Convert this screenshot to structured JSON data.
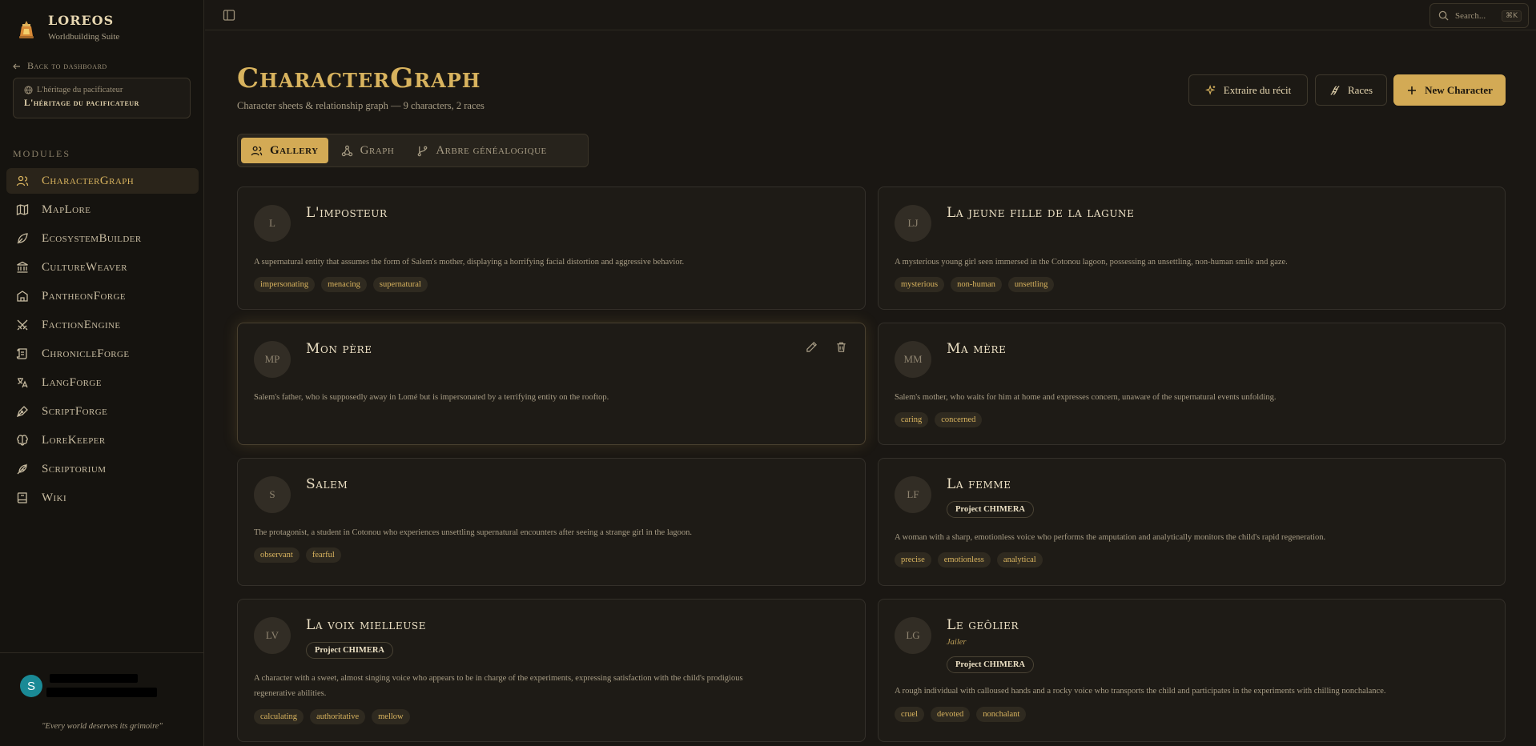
{
  "app": {
    "name": "LOREOS",
    "subtitle": "Worldbuilding Suite",
    "back_label": "Back to dashboard",
    "project_top": "L'héritage du pacificateur",
    "project_name": "L'héritage du pacificateur",
    "modules_label": "MODULES",
    "motto": "\"Every world deserves its grimoire\"",
    "user_initial": "S"
  },
  "nav": [
    {
      "label": "CharacterGraph",
      "icon": "users-icon",
      "active": true
    },
    {
      "label": "MapLore",
      "icon": "map-icon"
    },
    {
      "label": "EcosystemBuilder",
      "icon": "leaf-icon"
    },
    {
      "label": "CultureWeaver",
      "icon": "landmark-icon"
    },
    {
      "label": "PantheonForge",
      "icon": "temple-icon"
    },
    {
      "label": "FactionEngine",
      "icon": "swords-icon"
    },
    {
      "label": "ChronicleForge",
      "icon": "scroll-icon"
    },
    {
      "label": "LangForge",
      "icon": "languages-icon"
    },
    {
      "label": "ScriptForge",
      "icon": "pen-nib-icon"
    },
    {
      "label": "LoreKeeper",
      "icon": "brain-icon"
    },
    {
      "label": "Scriptorium",
      "icon": "feather-icon"
    },
    {
      "label": "Wiki",
      "icon": "book-icon"
    }
  ],
  "topbar": {
    "search_placeholder": "Search...",
    "search_shortcut": "⌘K"
  },
  "header": {
    "title": "CharacterGraph",
    "subtitle": "Character sheets & relationship graph — 9 characters, 2 races",
    "extract_label": "Extraire du récit",
    "races_label": "Races",
    "new_label": "New Character"
  },
  "tabs": [
    {
      "label": "Gallery",
      "active": true
    },
    {
      "label": "Graph"
    },
    {
      "label": "Arbre généalogique"
    }
  ],
  "characters": [
    {
      "initials": "L",
      "name": "L'imposteur",
      "desc": "A supernatural entity that assumes the form of Salem's mother, displaying a horrifying facial distortion and aggressive behavior.",
      "tags": [
        "impersonating",
        "menacing",
        "supernatural"
      ]
    },
    {
      "initials": "LJ",
      "name": "La jeune fille de la lagune",
      "desc": "A mysterious young girl seen immersed in the Cotonou lagoon, possessing an unsettling, non-human smile and gaze.",
      "tags": [
        "mysterious",
        "non-human",
        "unsettling"
      ]
    },
    {
      "initials": "MP",
      "name": "Mon père",
      "desc": "Salem's father, who is supposedly away in Lomé but is impersonated by a terrifying entity on the rooftop.",
      "tags": []
    },
    {
      "initials": "MM",
      "name": "Ma mère",
      "desc": "Salem's mother, who waits for him at home and expresses concern, unaware of the supernatural events unfolding.",
      "tags": [
        "caring",
        "concerned"
      ]
    },
    {
      "initials": "S",
      "name": "Salem",
      "desc": "The protagonist, a student in Cotonou who experiences unsettling supernatural encounters after seeing a strange girl in the lagoon.",
      "tags": [
        "observant",
        "fearful"
      ]
    },
    {
      "initials": "LF",
      "name": "La femme",
      "badge": "Project CHIMERA",
      "desc": "A woman with a sharp, emotionless voice who performs the amputation and analytically monitors the child's rapid regeneration.",
      "tags": [
        "precise",
        "emotionless",
        "analytical"
      ]
    },
    {
      "initials": "LV",
      "name": "La voix mielleuse",
      "badge": "Project CHIMERA",
      "desc_line1": "A character with a sweet, almost singing voice who appears to be in charge of the experiments, expressing satisfaction with the child's prodigious",
      "desc_line2": "regenerative abilities.",
      "tags": [
        "calculating",
        "authoritative",
        "mellow"
      ]
    },
    {
      "initials": "LG",
      "name": "Le geôlier",
      "role": "Jailer",
      "badge": "Project CHIMERA",
      "desc": "A rough individual with calloused hands and a rocky voice who transports the child and participates in the experiments with chilling nonchalance.",
      "tags": [
        "cruel",
        "devoted",
        "nonchalant"
      ]
    }
  ],
  "colors": {
    "accent": "#d3aa55",
    "background": "#1a1713",
    "sidebar": "#15130f",
    "avatar": "#1a8a96"
  }
}
